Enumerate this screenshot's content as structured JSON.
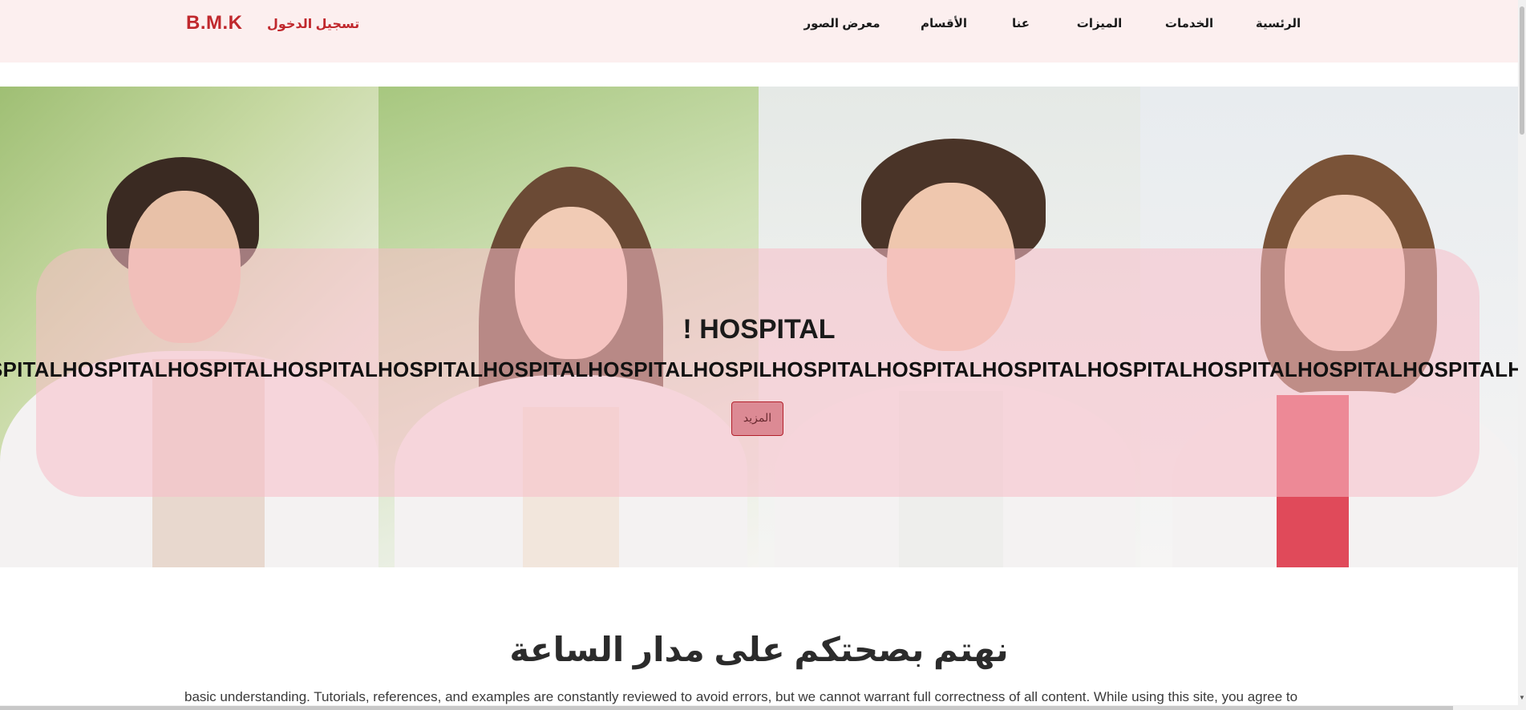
{
  "navbar": {
    "brand": "B.M.K",
    "login": "تسجيل الدخول",
    "links": [
      "الرئسية",
      "الخدمات",
      "الميزات",
      "عنا",
      "الأقسام",
      "معرض الصور"
    ]
  },
  "hero": {
    "title": "! HOSPITAL",
    "marquee": "SPITALHOSPITALHOSPITALHOSPITALHOSPITALHOSPITALHOSPITALHOSPILHOSPITALHOSPITALHOSPITALHOSPITALHOSPITALHOSPITALHOSPITALH",
    "more_button": "المزيد"
  },
  "section": {
    "title": "نهتم بصحتكم على مدار الساعة",
    "text": "basic understanding. Tutorials, references, and examples are constantly reviewed to avoid errors, but we cannot warrant full correctness of all content. While using this site, you agree to"
  },
  "colors": {
    "navbar_bg": "#fcefef",
    "brand": "#c0282d",
    "overlay": "#f7bec8"
  }
}
